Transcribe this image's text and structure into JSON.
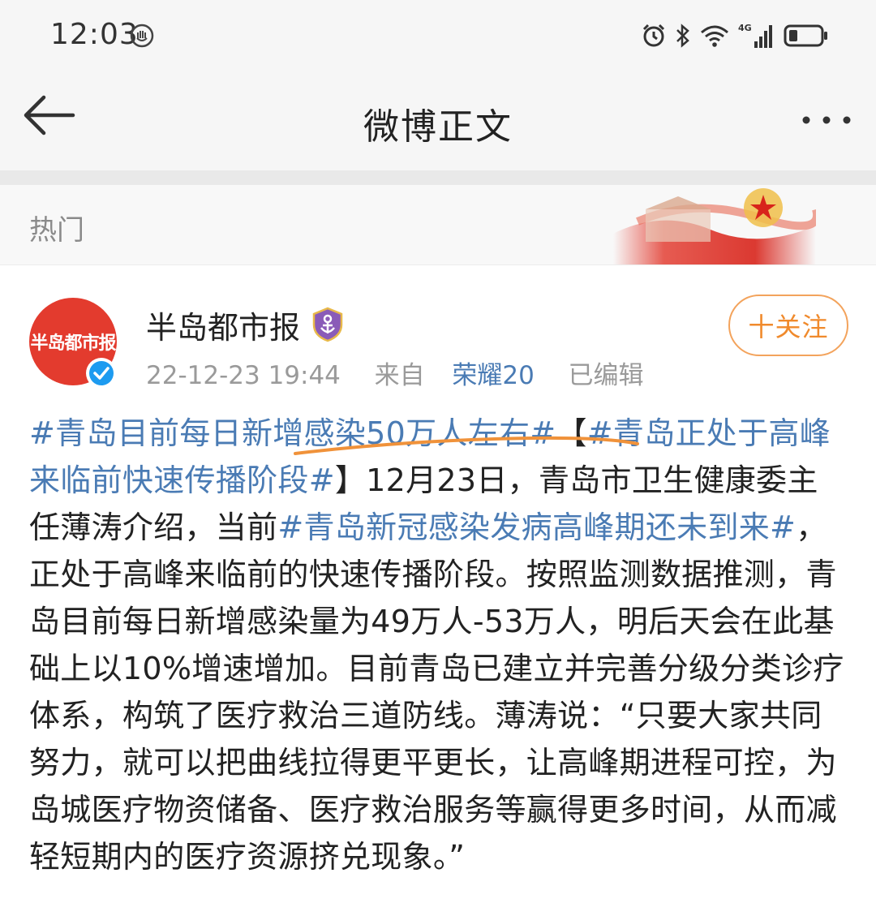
{
  "status_bar": {
    "time": "12:03",
    "icons": [
      "hand-icon",
      "alarm-icon",
      "bluetooth-icon",
      "wifi-icon",
      "signal-4g-icon",
      "battery-icon"
    ],
    "network_label": "4G"
  },
  "nav": {
    "title": "微博正文",
    "back_icon": "back-arrow-icon",
    "more_icon": "more-dots-icon"
  },
  "hot": {
    "label": "热门"
  },
  "post": {
    "author": "半岛都市报",
    "avatar_text": "半岛都市报",
    "timestamp": "22-12-23 19:44",
    "source_prefix": "来自",
    "source_device": "荣耀20",
    "edited": "已编辑",
    "follow_label": "十关注",
    "content": [
      {
        "type": "tag",
        "text": "#青岛目前每日新增感染50万人左右#"
      },
      {
        "type": "text",
        "text": "【"
      },
      {
        "type": "tag",
        "text": "#青岛正处于高峰来临前快速传播阶段#"
      },
      {
        "type": "text",
        "text": "】12月23日，青岛市卫生健康委主任薄涛介绍，当前"
      },
      {
        "type": "tag",
        "text": "#青岛新冠感染发病高峰期还未到来#"
      },
      {
        "type": "text",
        "text": "，正处于高峰来临前的快速传播阶段。按照监测数据推测，青岛目前每日新增感染量为49万人-53万人，明后天会在此基础上以10%增速增加。目前青岛已建立并完善分级分类诊疗体系，构筑了医疗救治三道防线。薄涛说：“只要大家共同努力，就可以把曲线拉得更平更长，让高峰期进程可控，为岛城医疗物资储备、医疗救治服务等赢得更多时间，从而减轻短期内的医疗资源挤兑现象。”"
      }
    ]
  },
  "colors": {
    "link": "#4a7bb4",
    "follow": "#f08a2c",
    "avatar_bg": "#e33b2e",
    "verified": "#1d9bf0",
    "underline": "#f0923a"
  }
}
